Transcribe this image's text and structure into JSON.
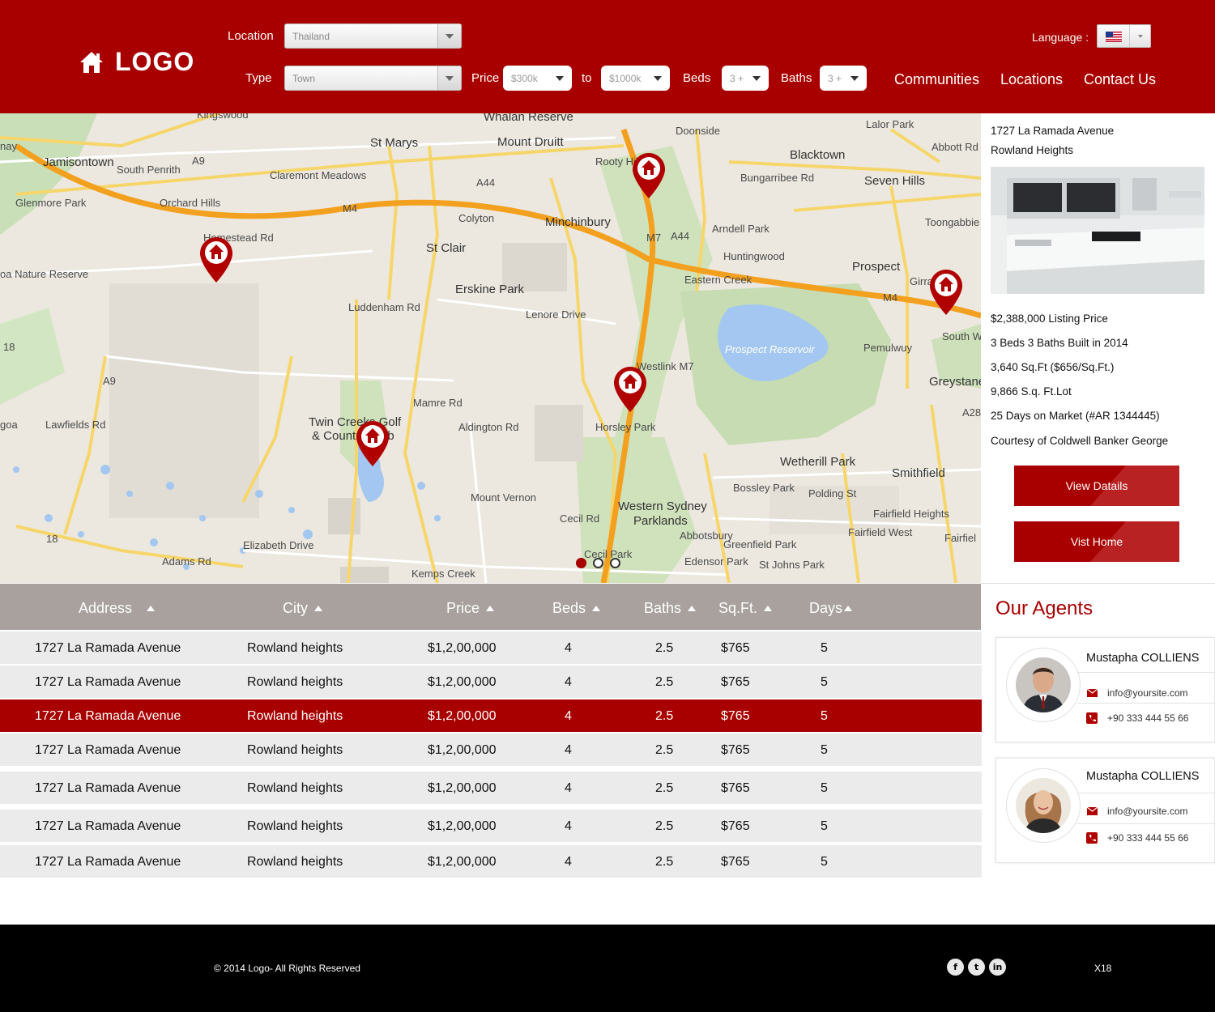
{
  "header": {
    "logo_text": "LOGO",
    "location_label": "Location",
    "location_value": "Thailand",
    "type_label": "Type",
    "type_value": "Town",
    "price_label": "Price",
    "price_min": "$300k",
    "to_label": "to",
    "price_max": "$1000k",
    "beds_label": "Beds",
    "beds_value": "3 +",
    "baths_label": "Baths",
    "baths_value": "3 +",
    "language_label": "Language :",
    "nav": [
      "Communities",
      "Locations",
      "Contact Us"
    ]
  },
  "map": {
    "labels": [
      "Kingswood",
      "Whalan Reserve",
      "Doonside",
      "Lalor Park",
      "St Marys",
      "Mount Druitt",
      "Blacktown",
      "Abbott Rd",
      "Jamisontown",
      "South Penrith",
      "Claremont Meadows",
      "Rooty Hill",
      "Bungarribee Rd",
      "Seven Hills",
      "A44",
      "A9",
      "Glenmore Park",
      "Orchard Hills",
      "M4",
      "Colyton",
      "Minchinbury",
      "Arndell Park",
      "Toongabbie",
      "Homestead Rd",
      "M7",
      "A44",
      "Huntingwood",
      "Prospect",
      "St Clair",
      "Eastern Creek",
      "Girra",
      "Nature Reserve",
      "Erskine Park",
      "M4",
      "Lenore Drive",
      "Prospect Reservoir",
      "South W",
      "18",
      "Luddenham Rd",
      "Pemulwuy",
      "A9",
      "Greystane",
      "Twin Creeks Golf",
      "& Country Club",
      "Mamre Rd",
      "Aldington Rd",
      "Horsley Park",
      "Westlink M7",
      "A28",
      "Wetherill Park",
      "Smithfield",
      "Bossley Park",
      "Polding St",
      "Fairfield Heights",
      "Mount Vernon",
      "Western Sydney",
      "Parklands",
      "Fairfield West",
      "Fairfiel",
      "18",
      "Cecil Rd",
      "Abbotsbury",
      "Greenfield Park",
      "Elizabeth Drive",
      "Cecil Park",
      "Edensor Park",
      "St Johns Park",
      "Adams Rd",
      "Kemps Creek",
      "Luddenham Rd",
      "Lawfields Rd",
      "oa Nature Reserve",
      "goa",
      "nay"
    ]
  },
  "listing": {
    "address_line1": "1727 La Ramada Avenue",
    "address_line2": "Rowland Heights",
    "price": "$2,388,000 Listing Price",
    "beds_baths": "3 Beds 3 Baths Built in 2014",
    "sqft": "3,640 Sq.Ft ($656/Sq.Ft.)",
    "lot": "9,866 S.q. Ft.Lot",
    "days": "25 Days on Market (#AR 1344445)",
    "courtesy": "Courtesy of Coldwell Banker George",
    "view_button": "View Datails",
    "visit_button": "Vist Home"
  },
  "table": {
    "headers": [
      "Address",
      "City",
      "Price",
      "Beds",
      "Baths",
      "Sq.Ft.",
      "Days"
    ],
    "rows": [
      [
        "1727 La Ramada Avenue",
        "Rowland heights",
        "$1,2,00,000",
        "4",
        "2.5",
        "$765",
        "5"
      ],
      [
        "1727 La Ramada Avenue",
        "Rowland heights",
        "$1,2,00,000",
        "4",
        "2.5",
        "$765",
        "5"
      ],
      [
        "1727 La Ramada Avenue",
        "Rowland heights",
        "$1,2,00,000",
        "4",
        "2.5",
        "$765",
        "5"
      ],
      [
        "1727 La Ramada Avenue",
        "Rowland heights",
        "$1,2,00,000",
        "4",
        "2.5",
        "$765",
        "5"
      ],
      [
        "1727 La Ramada Avenue",
        "Rowland heights",
        "$1,2,00,000",
        "4",
        "2.5",
        "$765",
        "5"
      ],
      [
        "1727 La Ramada Avenue",
        "Rowland heights",
        "$1,2,00,000",
        "4",
        "2.5",
        "$765",
        "5"
      ],
      [
        "1727 La Ramada Avenue",
        "Rowland heights",
        "$1,2,00,000",
        "4",
        "2.5",
        "$765",
        "5"
      ]
    ],
    "selected_row": 2
  },
  "agents": {
    "title": "Our Agents",
    "list": [
      {
        "name": "Mustapha COLLIENS",
        "email": "info@yoursite.com",
        "phone": "+90 333 444 55 66"
      },
      {
        "name": "Mustapha COLLIENS",
        "email": "info@yoursite.com",
        "phone": "+90 333 444 55 66"
      }
    ]
  },
  "footer": {
    "copyright": "© 2014 Logo- All Rights Reserved",
    "social": [
      "f",
      "t",
      "in"
    ],
    "tag": "X18"
  },
  "colors": {
    "brand_red": "#a80000",
    "table_header": "#a8a19d",
    "row_bg": "#ebebeb"
  }
}
